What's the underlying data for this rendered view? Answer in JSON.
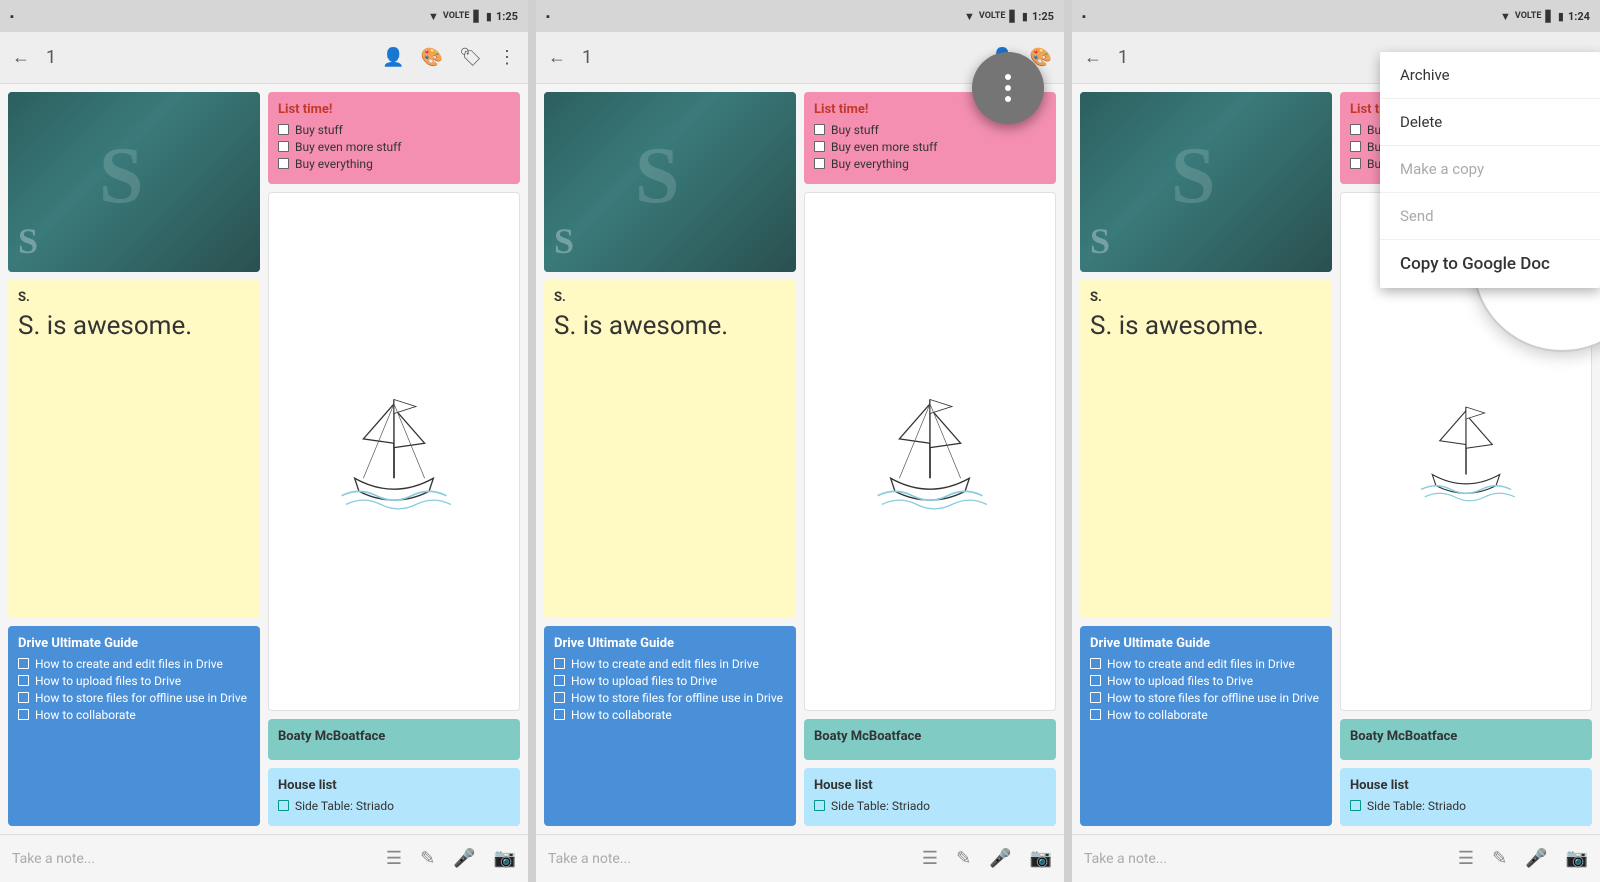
{
  "panels": [
    {
      "id": "panel1",
      "status": {
        "left": "📷",
        "signal": "▼",
        "network": "VOLTE",
        "bars": "▂▄▆",
        "battery": "🔋",
        "time": "1:25"
      },
      "appbar": {
        "back": "←",
        "number": "1",
        "icons": [
          "👤",
          "🎨",
          "🏷",
          "⋮"
        ]
      },
      "bottombar": {
        "placeholder": "Take a note...",
        "icons": [
          "☰",
          "✏",
          "🎤",
          "📷"
        ]
      }
    },
    {
      "id": "panel2",
      "status": {
        "time": "1:25"
      },
      "appbar": {
        "back": "←",
        "number": "1"
      },
      "bottombar": {
        "placeholder": "Take a note...",
        "icons": [
          "☰",
          "✏",
          "🎤",
          "📷"
        ]
      }
    },
    {
      "id": "panel3",
      "status": {
        "time": "1:24"
      },
      "appbar": {
        "back": "←",
        "number": "1"
      },
      "dropdown": {
        "items": [
          "Archive",
          "Delete",
          "Make a copy",
          "Send",
          "Copy to Google Doc"
        ]
      },
      "magnify_label": "Copy to Google Doc",
      "bottombar": {
        "placeholder": "Take a note...",
        "icons": [
          "☰",
          "✏",
          "🎤",
          "📷"
        ]
      }
    }
  ],
  "cards": {
    "pink": {
      "title": "List time!",
      "items": [
        "Buy stuff",
        "Buy even more stuff",
        "Buy everything"
      ]
    },
    "yellow": {
      "letter": "S.",
      "text": "S. is awesome."
    },
    "blue_guide": {
      "title": "Drive Ultimate Guide",
      "items": [
        "How to create and edit files in Drive",
        "How to upload files to Drive",
        "How to store files for offline use in Drive",
        "How to collaborate"
      ]
    },
    "teal_boaty": {
      "title": "Boaty McBoatface"
    },
    "house_list": {
      "title": "House list",
      "items": [
        "Side Table: Striado"
      ]
    }
  }
}
